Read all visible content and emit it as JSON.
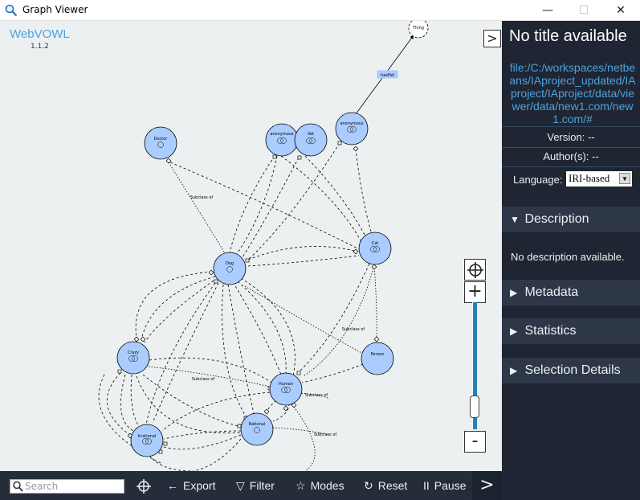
{
  "window": {
    "title": "Graph Viewer",
    "min_glyph": "—",
    "max_glyph": "☐",
    "close_glyph": "✕"
  },
  "brand": {
    "name": "WebVOWL",
    "version": "1.1.2"
  },
  "graph": {
    "nodes": [
      {
        "id": "thing",
        "label": "Thing"
      },
      {
        "id": "doctor",
        "label": "Doctor"
      },
      {
        "id": "anon1",
        "label": "anonymous"
      },
      {
        "id": "vet",
        "label": "Vet"
      },
      {
        "id": "anon2",
        "label": "anonymous"
      },
      {
        "id": "dog",
        "label": "Dog"
      },
      {
        "id": "cat",
        "label": "Cat"
      },
      {
        "id": "crazy",
        "label": "Crazy"
      },
      {
        "id": "person",
        "label": "Person"
      },
      {
        "id": "human",
        "label": "Human"
      },
      {
        "id": "rational",
        "label": "Rational"
      },
      {
        "id": "irrational",
        "label": "Irrational"
      }
    ],
    "property_labels": {
      "has_pet": "hasPet",
      "subclass_1": "Subclass of",
      "subclass_2": "Subclass of",
      "subclass_3": "Subclass of",
      "subclass_4": "Subclass of",
      "subclass_5": "Subclass of"
    }
  },
  "zoom": {
    "center_glyph": "⌖",
    "plus": "+",
    "minus": "-",
    "level": 0.25
  },
  "toolbar": {
    "search_placeholder": "Search",
    "center_glyph": "⌖",
    "export_icon": "←",
    "export_label": "Export",
    "filter_icon": "▽",
    "filter_label": "Filter",
    "modes_icon": "☆",
    "modes_label": "Modes",
    "reset_icon": "↻",
    "reset_label": "Reset",
    "pause_icon": "II",
    "pause_label": "Pause",
    "toggle_glyph": ">"
  },
  "sidebar": {
    "toggle_glyph": ">",
    "title": "No title available",
    "iri": "file:/C:/workspaces/netbeans/IAproject_updated/IAproject/IAproject/data/viewer/data/new1.com/new1.com/#",
    "version": "Version: --",
    "authors": "Author(s): --",
    "language_label": "Language:",
    "language_value": "IRI-based",
    "sections": {
      "description": "Description",
      "metadata": "Metadata",
      "statistics": "Statistics",
      "selection": "Selection Details"
    },
    "expanded_glyph": "▼",
    "collapsed_glyph": "▶",
    "description_text": "No description available."
  },
  "colors": {
    "canvas_bg": "#ecf0f1",
    "node_fill": "#aaccff",
    "node_stroke": "#000000",
    "sidebar_bg": "#1f2532",
    "toolbar_bg": "#252c3a",
    "accent": "#4aa3df",
    "property_fill": "#aaccff"
  }
}
